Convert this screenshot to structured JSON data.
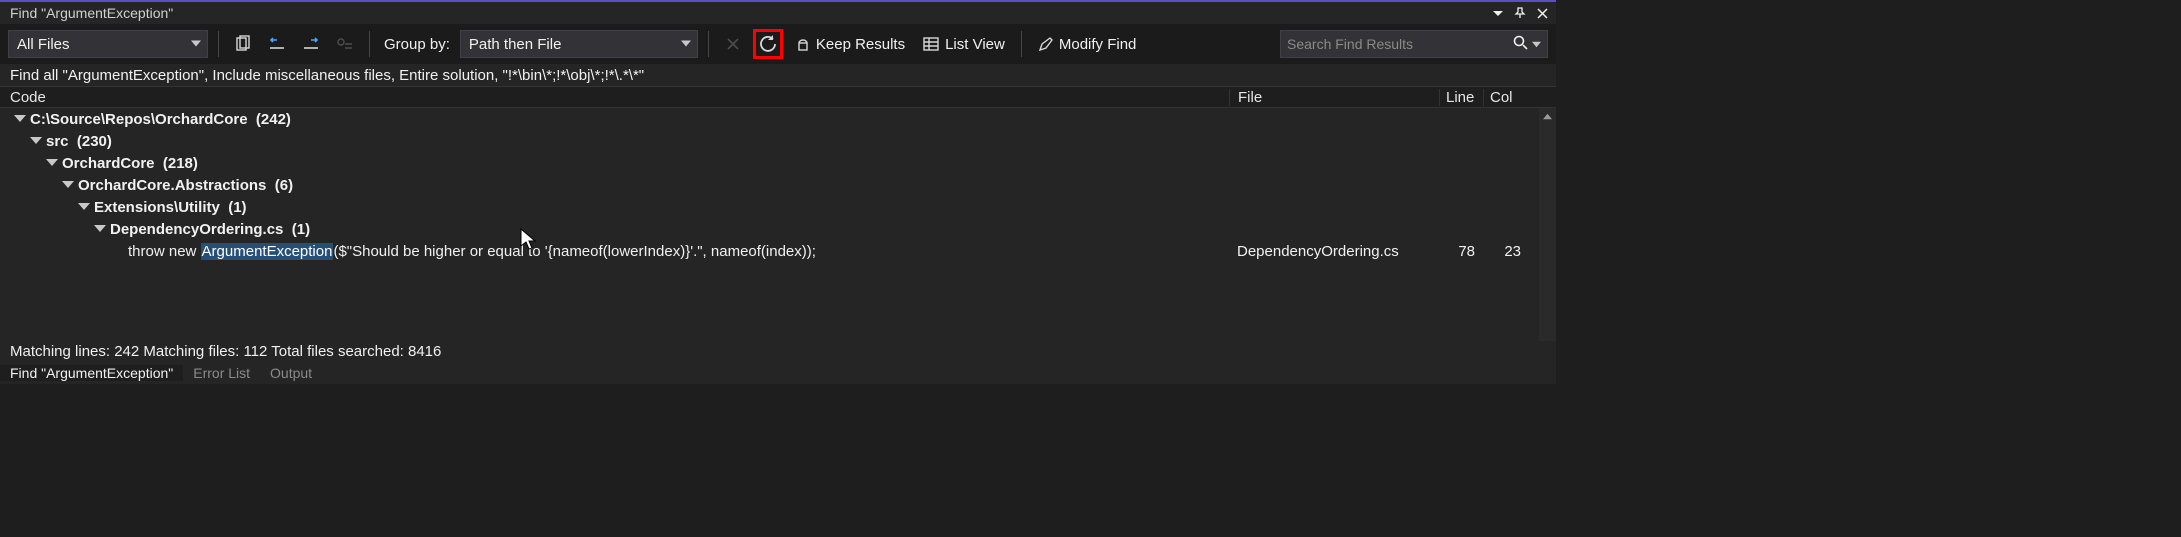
{
  "title": "Find \"ArgumentException\"",
  "window_controls": {
    "autohide": "▼",
    "pin": "📌",
    "close": "✕"
  },
  "toolbar": {
    "scope_selected": "All Files",
    "groupby_label": "Group by:",
    "groupby_selected": "Path then File",
    "keep_results": "Keep Results",
    "list_view": "List View",
    "modify_find": "Modify Find"
  },
  "search": {
    "placeholder": "Search Find Results"
  },
  "query_summary": "Find all \"ArgumentException\", Include miscellaneous files, Entire solution, \"!*\\bin\\*;!*\\obj\\*;!*\\.*\\*\"",
  "columns": {
    "code": "Code",
    "file": "File",
    "line": "Line",
    "col": "Col"
  },
  "tree": {
    "root": {
      "label": "C:\\Source\\Repos\\OrchardCore",
      "count": "(242)"
    },
    "l1": {
      "label": "src",
      "count": "(230)"
    },
    "l2": {
      "label": "OrchardCore",
      "count": "(218)"
    },
    "l3": {
      "label": "OrchardCore.Abstractions",
      "count": "(6)"
    },
    "l4": {
      "label": "Extensions\\Utility",
      "count": "(1)"
    },
    "l5": {
      "label": "DependencyOrdering.cs",
      "count": "(1)"
    }
  },
  "match": {
    "pre": "throw new ",
    "hit": "ArgumentException",
    "post": "($\"Should be higher or equal to '{nameof(lowerIndex)}'.\", nameof(index));",
    "file": "DependencyOrdering.cs",
    "line": "78",
    "col": "23"
  },
  "footer_summary": "Matching lines: 242 Matching files: 112 Total files searched: 8416",
  "tabs": {
    "active": "Find \"ArgumentException\"",
    "t1": "Error List",
    "t2": "Output"
  }
}
